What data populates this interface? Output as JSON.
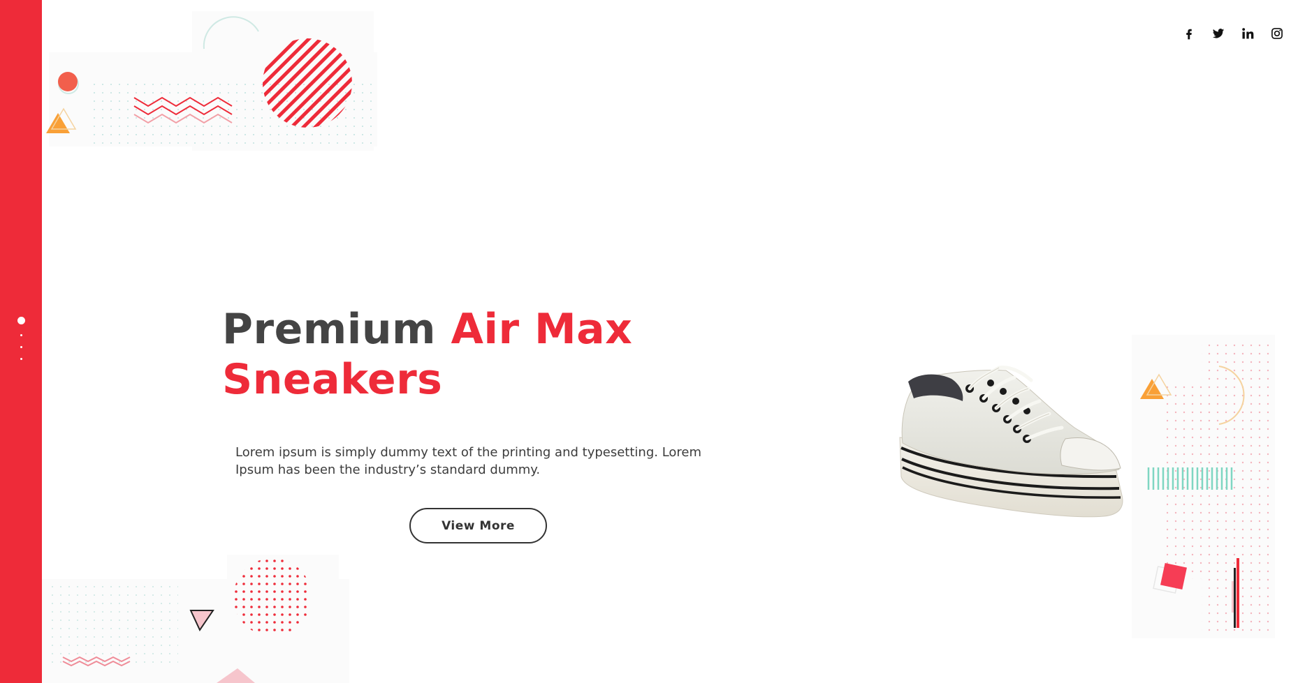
{
  "hero": {
    "title_part1": "Premium",
    "title_part2": "Air Max",
    "title_part3": "Sneakers",
    "description": "Lorem ipsum is simply dummy text of the printing and typesetting. Lorem Ipsum has been the industry’s standard dummy.",
    "button_label": "View More"
  },
  "slider": {
    "slide_count": 4,
    "active_index": 0
  },
  "social": {
    "icons": [
      "facebook-icon",
      "twitter-icon",
      "linkedin-icon",
      "instagram-icon"
    ]
  },
  "colors": {
    "accent": "#ee2b39",
    "heading": "#444444",
    "text": "#3c3c3c",
    "orange": "#f9a037",
    "mint": "#7fd6c2",
    "pink": "#f6c5cc"
  }
}
